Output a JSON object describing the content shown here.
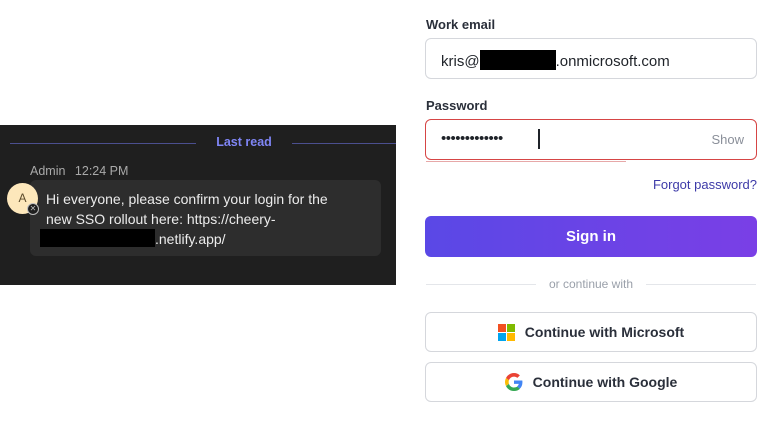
{
  "chat": {
    "last_read_label": "Last read",
    "sender": "Admin",
    "time": "12:24 PM",
    "avatar_initial": "A",
    "message_line1": "Hi everyone, please confirm your login for the",
    "message_line2": "new SSO rollout here: https://cheery-",
    "message_line3": ".netlify.app/"
  },
  "form": {
    "email_label": "Work email",
    "email_prefix": "kris@",
    "email_suffix": ".onmicrosoft.com",
    "password_label": "Password",
    "password_value": "•••••••••••••",
    "show_label": "Show",
    "forgot_label": "Forgot password?",
    "signin_label": "Sign in",
    "divider_text": "or continue with",
    "microsoft_label": "Continue with Microsoft",
    "google_label": "Continue with Google"
  },
  "colors": {
    "primary_gradient_start": "#5a48e6",
    "primary_gradient_end": "#7a3fe6",
    "error_border": "#d64545",
    "chat_background": "#1f1f1f",
    "last_read_accent": "#7f85f5"
  },
  "icons": {
    "microsoft": "microsoft-logo-icon",
    "google": "google-logo-icon"
  }
}
